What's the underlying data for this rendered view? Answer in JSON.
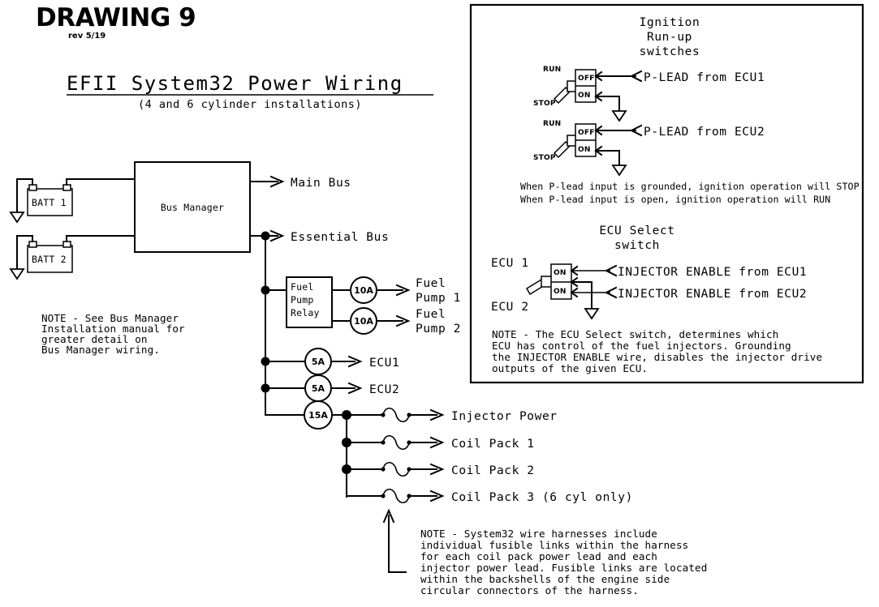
{
  "drawing": {
    "number_label": "DRAWING 9",
    "revision": "rev 5/19",
    "title": "EFII System32 Power Wiring",
    "subtitle": "(4 and 6 cylinder installations)"
  },
  "power_section": {
    "batteries": [
      {
        "label": "BATT 1"
      },
      {
        "label": "BATT 2"
      }
    ],
    "bus_manager": {
      "label": "Bus Manager"
    },
    "outputs": [
      {
        "label": "Main Bus"
      },
      {
        "label": "Essential Bus"
      }
    ],
    "fuel_pump_relay": {
      "line1": "Fuel",
      "line2": "Pump",
      "line3": "Relay"
    },
    "fused_branches": [
      {
        "fuse": "10A",
        "label_line1": "Fuel",
        "label_line2": "Pump 1"
      },
      {
        "fuse": "10A",
        "label_line1": "Fuel",
        "label_line2": "Pump 2"
      },
      {
        "fuse": "5A",
        "label_line1": "ECU1",
        "label_line2": ""
      },
      {
        "fuse": "5A",
        "label_line1": "ECU2",
        "label_line2": ""
      },
      {
        "fuse": "15A",
        "label_line1": "",
        "label_line2": ""
      }
    ],
    "fusible_link_loads": [
      {
        "label": "Injector Power"
      },
      {
        "label": "Coil Pack 1"
      },
      {
        "label": "Coil Pack 2"
      },
      {
        "label": "Coil Pack 3 (6 cyl only)"
      }
    ]
  },
  "notes": {
    "bus_manager_note": [
      "NOTE - See Bus Manager",
      "Installation manual for",
      "greater detail on",
      "Bus Manager wiring."
    ],
    "harness_note": [
      "NOTE - System32 wire harnesses include",
      "individual fusible links within the harness",
      "for each coil pack power lead and each",
      "injector power lead. Fusible links are located",
      "within the backshells of the engine side",
      "circular connectors of the harness."
    ],
    "ecu_select_note": [
      "NOTE - The ECU Select switch, determines which",
      "ECU has control of the fuel injectors. Grounding",
      "the INJECTOR ENABLE wire, disables the injector drive",
      "outputs of the given ECU."
    ]
  },
  "panel": {
    "ignition": {
      "heading": [
        "Ignition",
        "Run-up",
        "switches"
      ],
      "switches": [
        {
          "pos_up_label": "RUN",
          "pos_down_label": "STOP",
          "terminal_top": "OFF",
          "terminal_bottom": "ON",
          "lead_label": "P-LEAD from ECU1"
        },
        {
          "pos_up_label": "RUN",
          "pos_down_label": "STOP",
          "terminal_top": "OFF",
          "terminal_bottom": "ON",
          "lead_label": "P-LEAD from ECU2"
        }
      ],
      "description": [
        "When P-lead input is grounded, ignition operation will STOP",
        "When P-lead input is open, ignition operation will RUN"
      ]
    },
    "ecu_select": {
      "heading": [
        "ECU Select",
        "switch"
      ],
      "pos_up_label": "ECU 1",
      "pos_down_label": "ECU 2",
      "terminal_top": "ON",
      "terminal_bottom": "ON",
      "leads": [
        {
          "label": "INJECTOR ENABLE from ECU1"
        },
        {
          "label": "INJECTOR ENABLE from ECU2"
        }
      ]
    }
  },
  "colors": {
    "ink": "#000000",
    "paper": "#ffffff"
  }
}
